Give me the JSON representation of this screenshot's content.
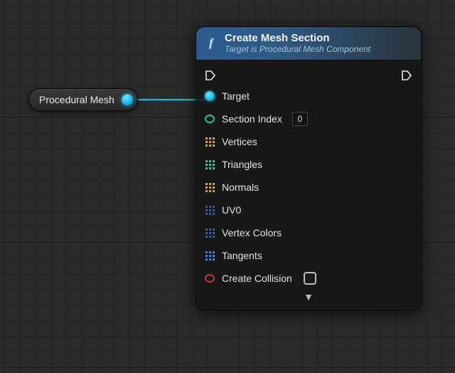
{
  "variable_node": {
    "label": "Procedural Mesh"
  },
  "node": {
    "title": "Create Mesh Section",
    "subtitle": "Target is Procedural Mesh Component",
    "pins": {
      "target": "Target",
      "section_index": {
        "label": "Section Index",
        "value": "0"
      },
      "vertices": "Vertices",
      "triangles": "Triangles",
      "normals": "Normals",
      "uv0": "UV0",
      "vertex_colors": "Vertex Colors",
      "tangents": "Tangents",
      "create_collision": {
        "label": "Create Collision",
        "checked": false
      }
    },
    "expand_glyph": "▼"
  }
}
